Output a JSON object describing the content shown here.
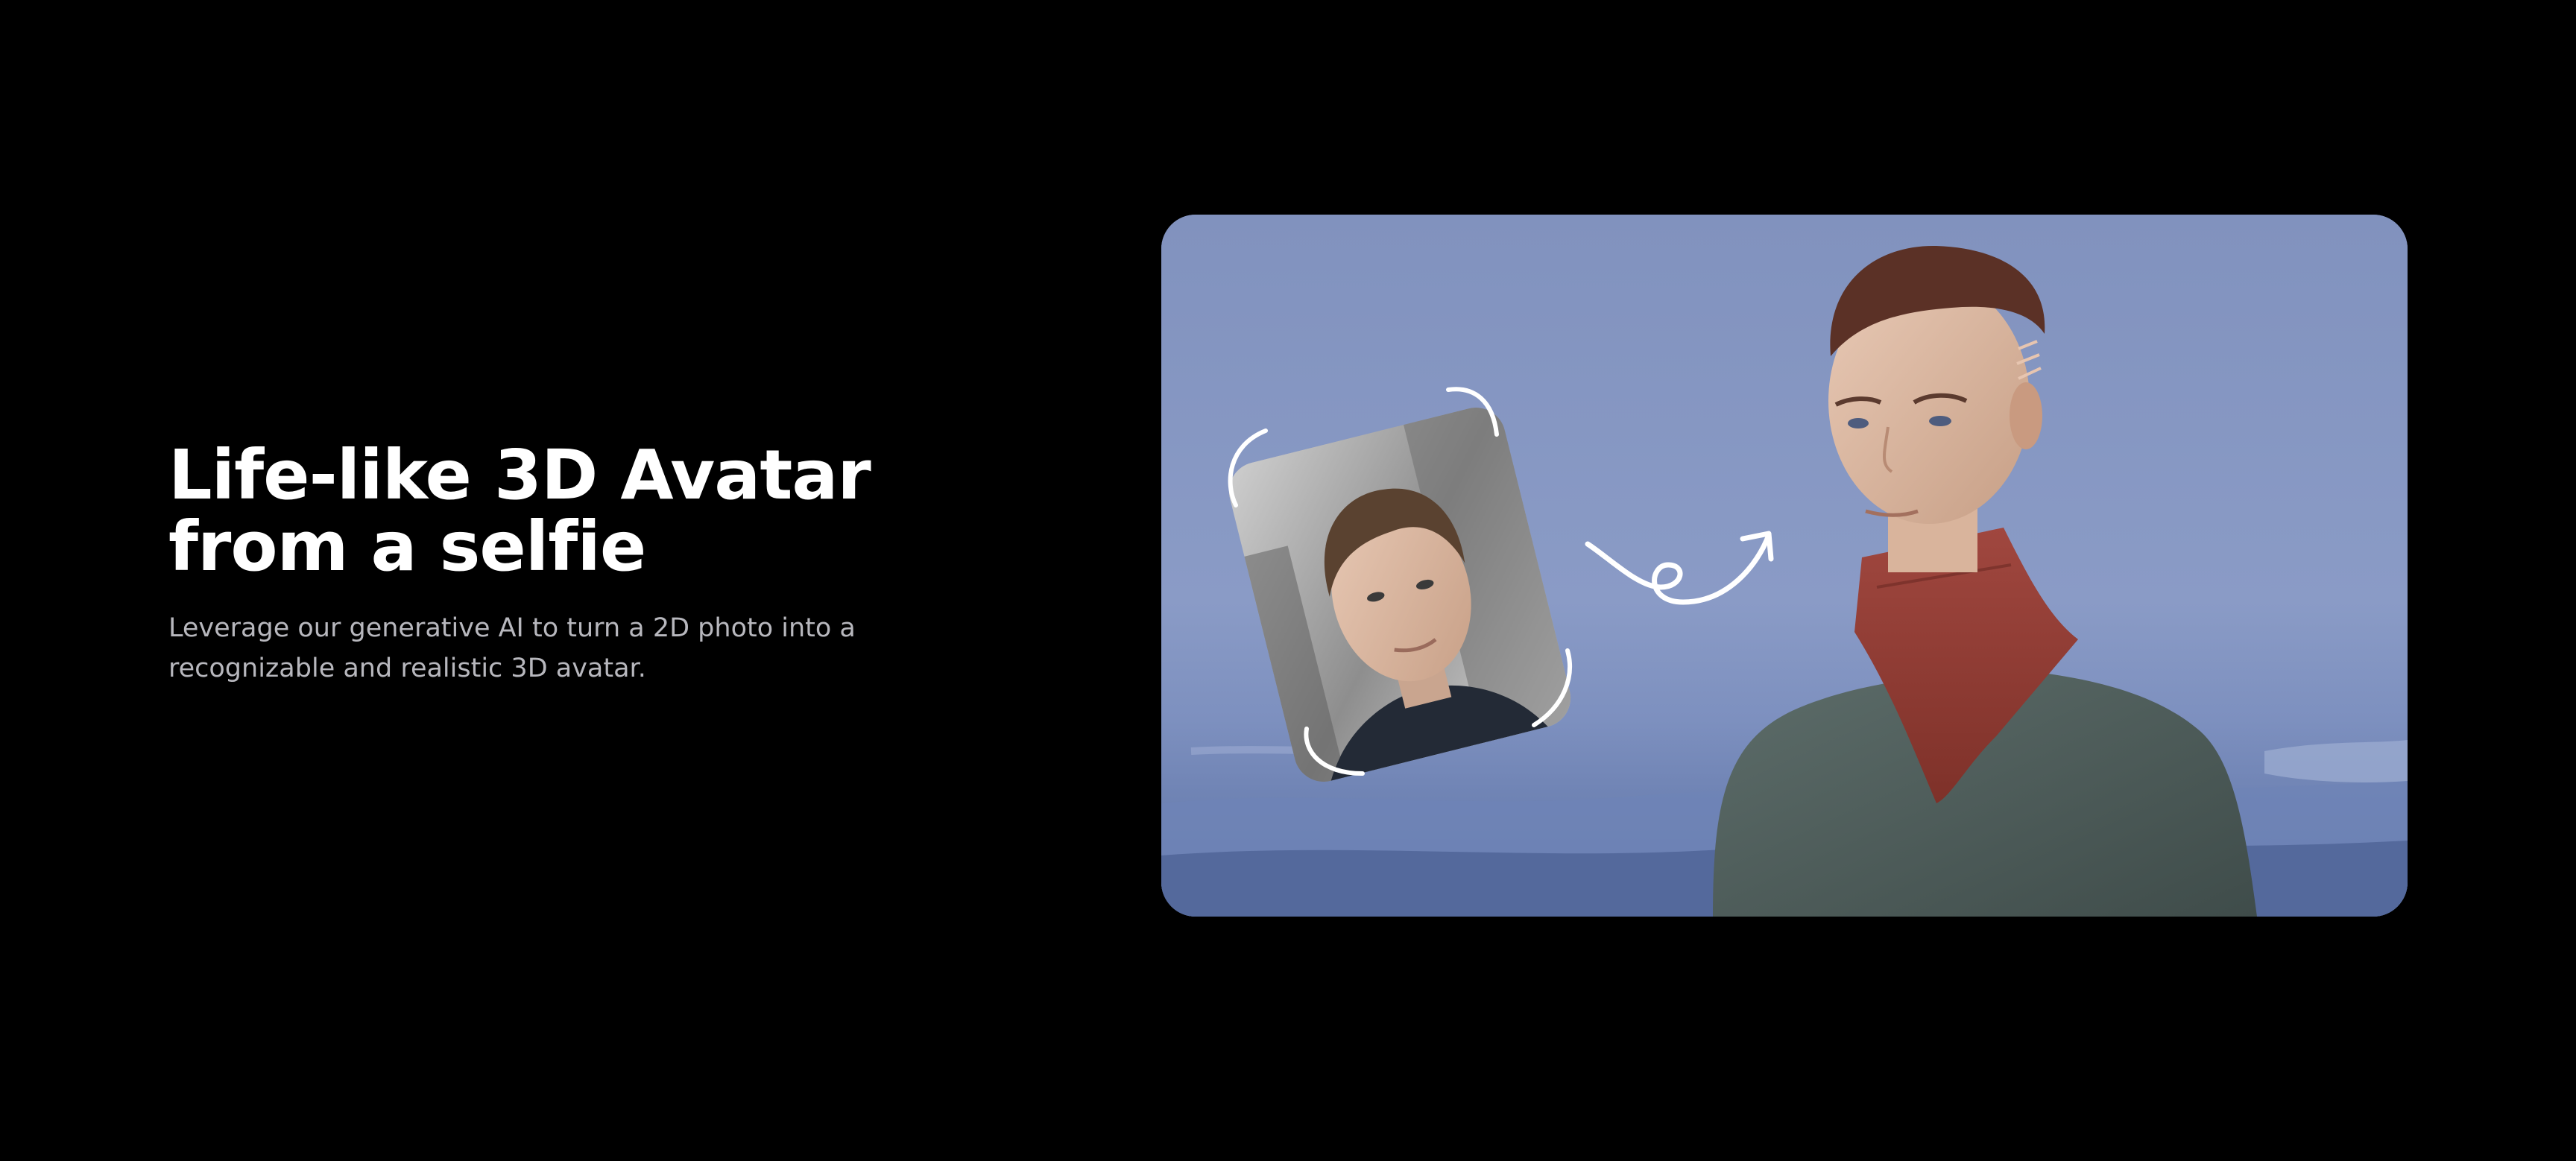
{
  "hero": {
    "headline_line1": "Life-like 3D Avatar",
    "headline_line2": "from a selfie",
    "subtext_line1": "Leverage our generative AI to turn a 2D photo into a",
    "subtext_line2": "recognizable and realistic 3D avatar."
  },
  "colors": {
    "page_background": "#000000",
    "headline": "#ffffff",
    "subtext": "#b7b7bd",
    "showcase_sky": "#8193bf"
  },
  "icons": {
    "transform_arrow": "curly-arrow-icon",
    "photo_frame": "scan-frame-icon"
  }
}
